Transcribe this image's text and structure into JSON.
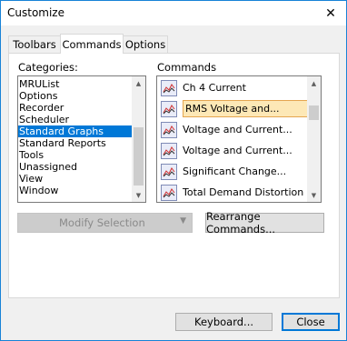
{
  "window": {
    "title": "Customize",
    "close_symbol": "✕"
  },
  "tabs": [
    {
      "label": "Toolbars",
      "active": false
    },
    {
      "label": "Commands",
      "active": true
    },
    {
      "label": "Options",
      "active": false
    }
  ],
  "categories": {
    "label": "Categories:",
    "items": [
      "MRUList",
      "Options",
      "Recorder",
      "Scheduler",
      "Standard Graphs",
      "Standard Reports",
      "Tools",
      "Unassigned",
      "View",
      "Window"
    ],
    "selected": "Standard Graphs"
  },
  "commands": {
    "label": "Commands",
    "items": [
      {
        "label": "Ch 4 Current",
        "icon": "graph-icon"
      },
      {
        "label": "RMS Voltage and...",
        "icon": "graph-icon",
        "selected": true
      },
      {
        "label": "Voltage and Current...",
        "icon": "graph-icon"
      },
      {
        "label": "Voltage and Current...",
        "icon": "graph-icon"
      },
      {
        "label": "Significant Change...",
        "icon": "graph-icon"
      },
      {
        "label": "Total Demand Distortion",
        "icon": "graph-icon"
      }
    ]
  },
  "buttons": {
    "modify_selection": "Modify Selection",
    "rearrange_commands": "Rearrange Commands...",
    "keyboard": "Keyboard...",
    "close": "Close"
  }
}
